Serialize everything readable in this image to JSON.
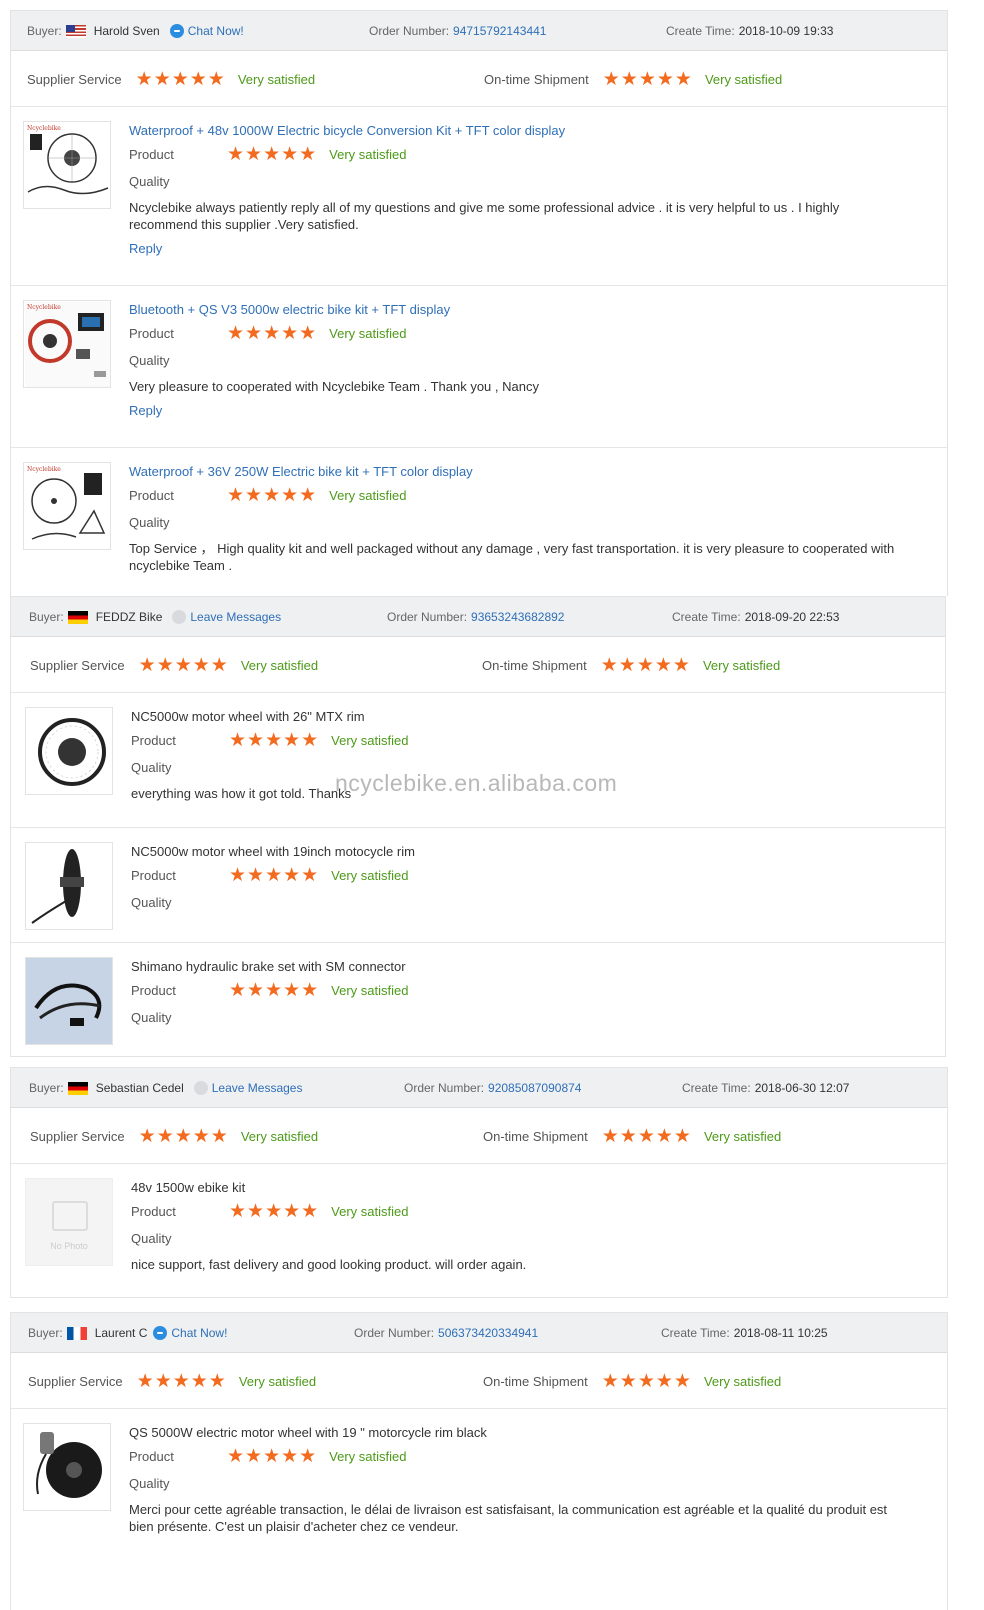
{
  "labels": {
    "buyer": "Buyer:",
    "order_number": "Order Number:",
    "create_time": "Create Time:",
    "supplier_service": "Supplier Service",
    "ontime_shipment": "On-time Shipment",
    "product": "Product",
    "quality": "Quality",
    "reply": "Reply",
    "stars": "★★★★★",
    "no_photo": "No Photo"
  },
  "watermark": "ncyclebike.en.alibaba.com",
  "colors": {
    "star": "#f26b1f",
    "satisfied": "#4c9a18",
    "link": "#2f6fb7",
    "header_bg": "#eef0f2"
  },
  "feedbacks": [
    {
      "buyer_name": "Harold Sven",
      "flag": "us-flag",
      "contact_action": "Chat Now!",
      "order_number": "94715792143441",
      "create_time": "2018-10-09 19:33",
      "rating_stars": 5,
      "supplier_service": "Very satisfied",
      "ontime_shipment": "Very satisfied",
      "products": [
        {
          "title": "Waterproof + 48v 1000W Electric bicycle Conversion Kit + TFT color display",
          "product_rating": "Very satisfied",
          "comment": "Ncyclebike always patiently reply all of my questions and give me some professional advice . it is very helpful to us . I highly recommend this supplier .Very satisfied.",
          "has_reply": true
        },
        {
          "title": "Bluetooth + QS V3 5000w electric bike kit + TFT display",
          "product_rating": "Very satisfied",
          "comment": "Very pleasure to cooperated with Ncyclebike Team . Thank you , Nancy",
          "has_reply": true
        },
        {
          "title": "Waterproof + 36V 250W Electric bike kit + TFT color display",
          "product_rating": "Very satisfied",
          "comment": "Top Service ， High quality kit and well packaged without any damage , very fast transportation. it is very pleasure to cooperated with ncyclebike Team .",
          "has_reply": false
        }
      ]
    },
    {
      "buyer_name": "FEDDZ Bike",
      "flag": "de-flag",
      "contact_action": "Leave Messages",
      "order_number": "93653243682892",
      "create_time": "2018-09-20 22:53",
      "supplier_service": "Very satisfied",
      "ontime_shipment": "Very satisfied",
      "products": [
        {
          "title": "NC5000w motor wheel with 26\" MTX rim",
          "product_rating": "Very satisfied",
          "comment": "everything was how it got told. Thanks"
        },
        {
          "title": "NC5000w motor wheel with 19inch motocycle rim",
          "product_rating": "Very satisfied",
          "comment": ""
        },
        {
          "title": "Shimano hydraulic brake set with SM connector",
          "product_rating": "Very satisfied",
          "comment": ""
        }
      ]
    },
    {
      "buyer_name": "Sebastian Cedel",
      "flag": "de-flag",
      "contact_action": "Leave Messages",
      "order_number": "92085087090874",
      "create_time": "2018-06-30 12:07",
      "supplier_service": "Very satisfied",
      "ontime_shipment": "Very satisfied",
      "products": [
        {
          "title": "48v 1500w ebike kit",
          "product_rating": "Very satisfied",
          "comment": "nice support, fast delivery and good looking product. will order again."
        }
      ]
    },
    {
      "buyer_name": "Laurent C",
      "flag": "fr-flag",
      "contact_action": "Chat Now!",
      "order_number": "506373420334941",
      "create_time": "2018-08-11 10:25",
      "supplier_service": "Very satisfied",
      "ontime_shipment": "Very satisfied",
      "products": [
        {
          "title": "QS 5000W electric motor wheel with 19 \" motorcycle rim black",
          "product_rating": "Very satisfied",
          "comment": "Merci pour cette agréable transaction, le délai de livraison est satisfaisant, la communication est agréable et la qualité du produit est bien présente. C'est un plaisir d'acheter chez ce vendeur."
        }
      ]
    }
  ]
}
